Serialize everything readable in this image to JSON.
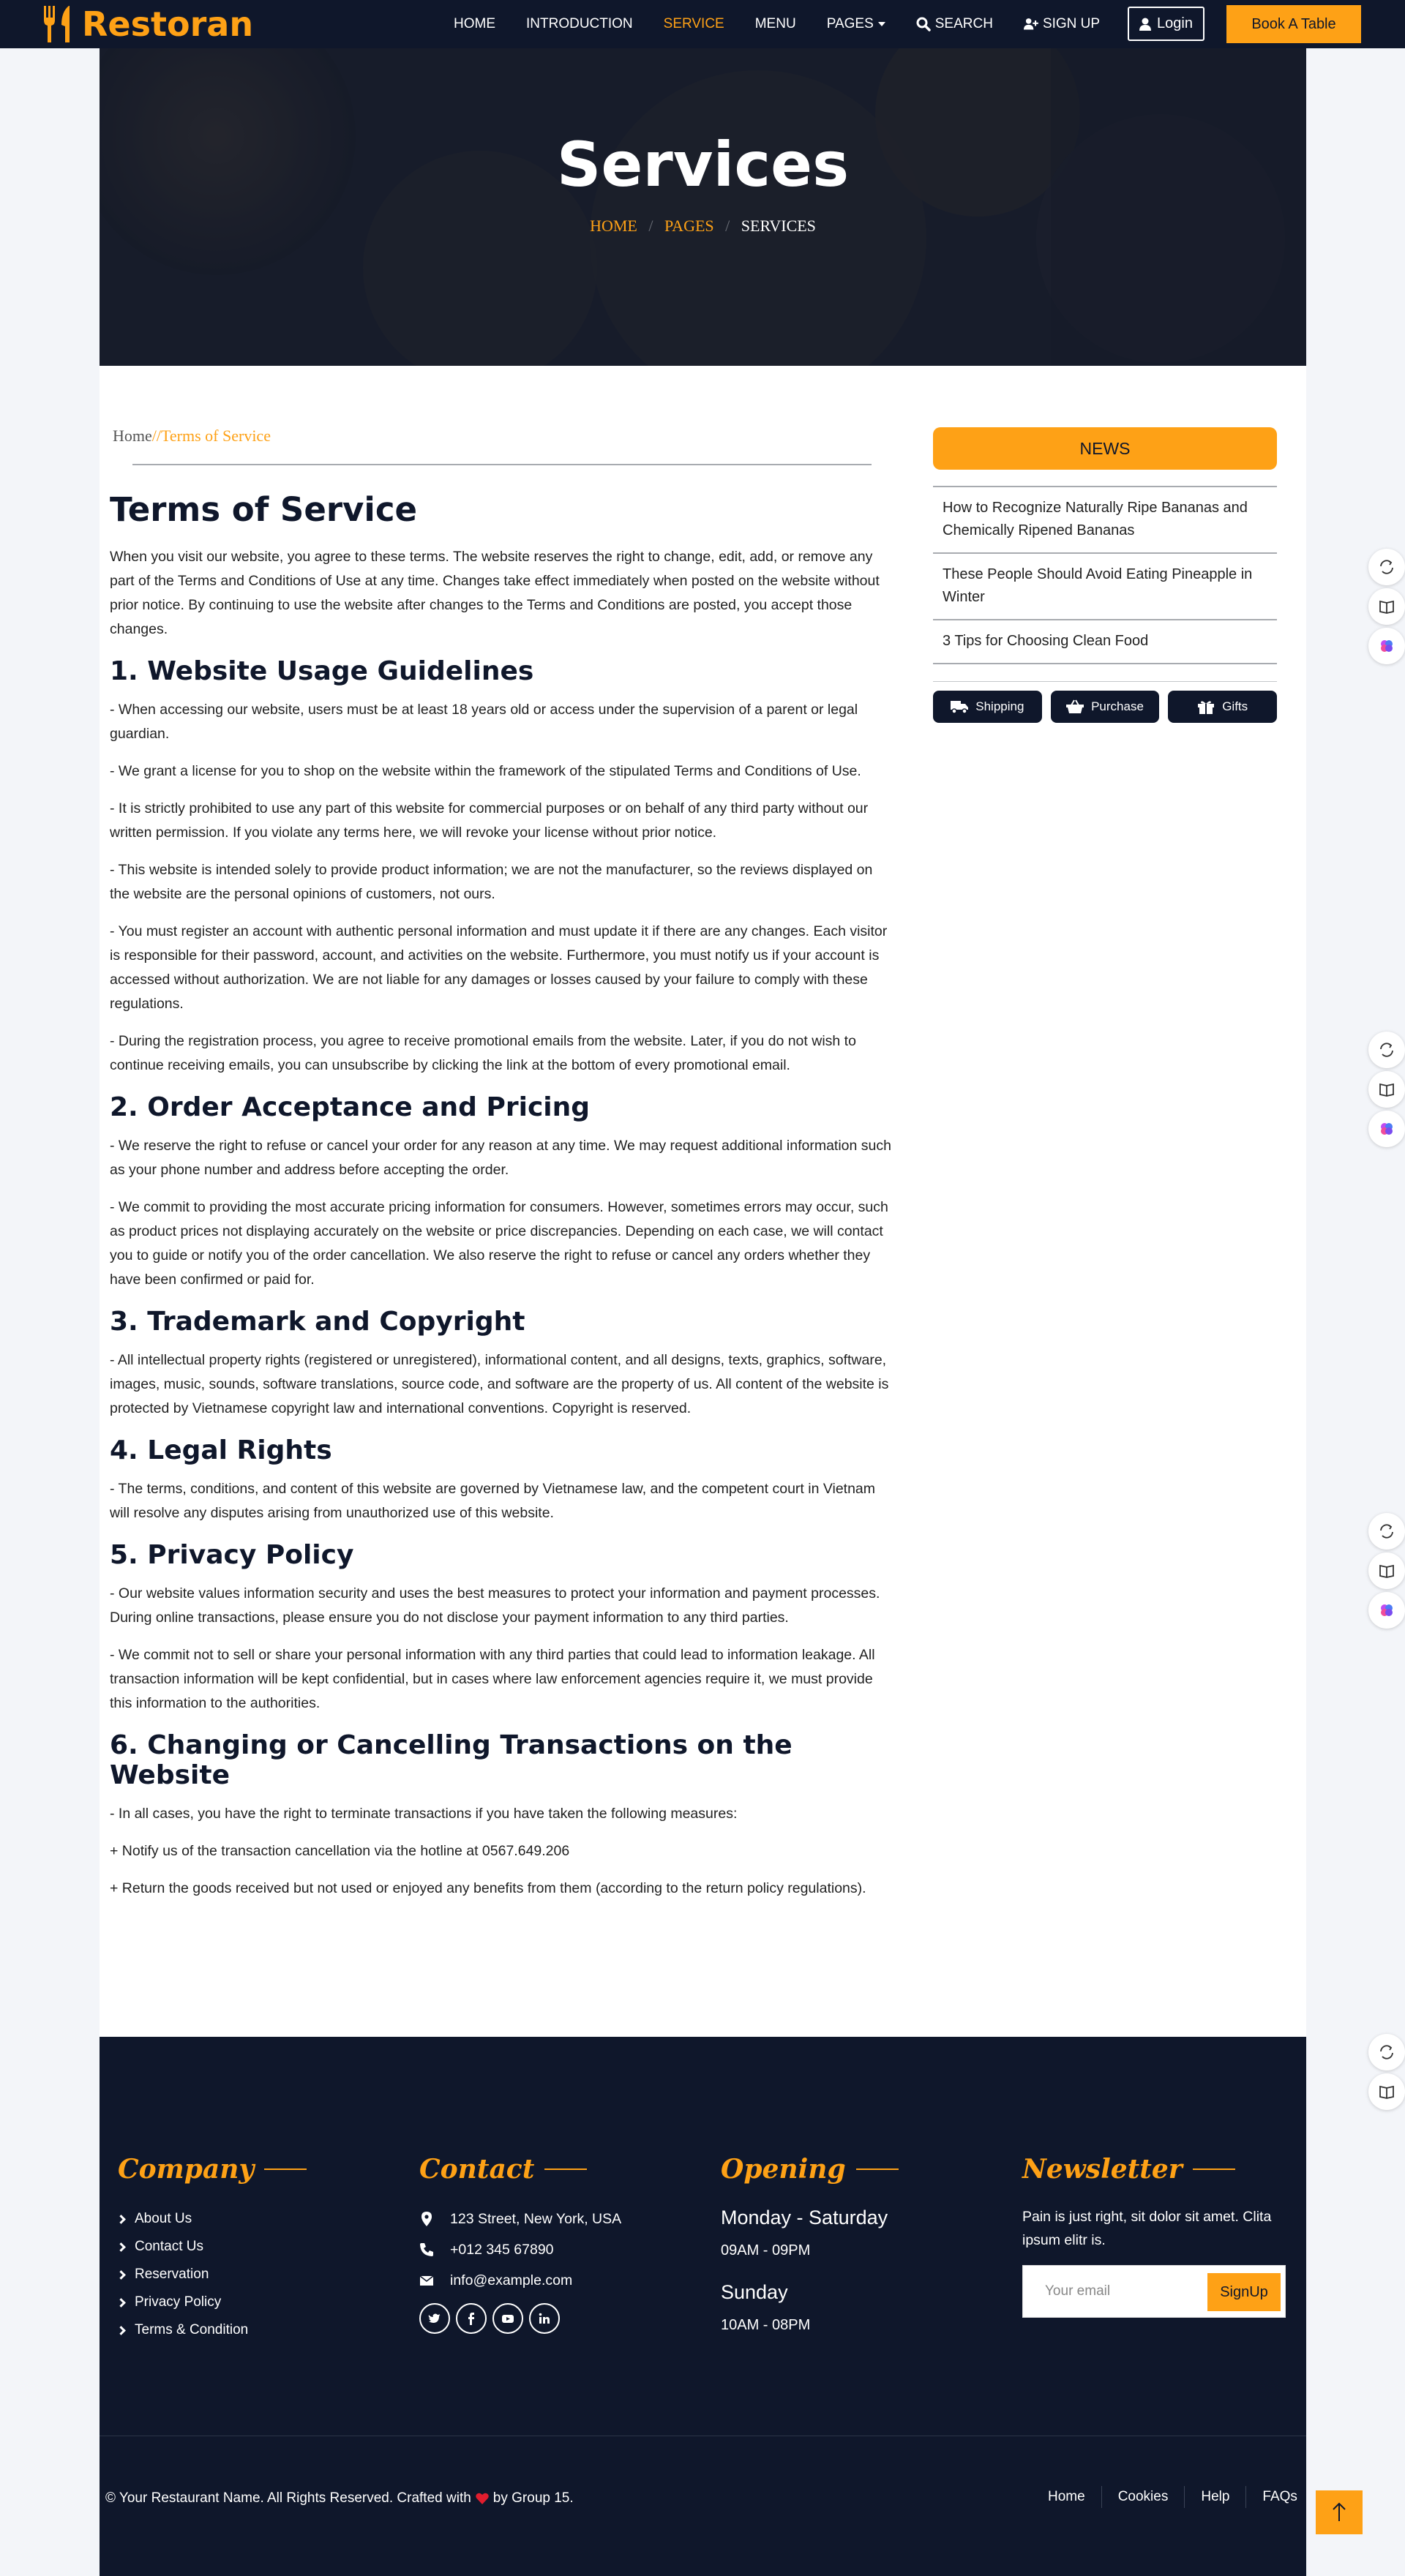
{
  "brand": {
    "name": "Restoran"
  },
  "nav": {
    "items": [
      {
        "label": "HOME"
      },
      {
        "label": "INTRODUCTION"
      },
      {
        "label": "SERVICE"
      },
      {
        "label": "MENU"
      },
      {
        "label": "PAGES"
      }
    ],
    "search_label": "SEARCH",
    "signup_label": "SIGN UP",
    "login_label": "Login",
    "book_label": "Book A Table"
  },
  "hero": {
    "title": "Services",
    "breadcrumb": {
      "home": "HOME",
      "sep": "/",
      "pages": "PAGES",
      "current": "SERVICES"
    }
  },
  "page_breadcrumb": {
    "home": "Home",
    "sep": "//",
    "current": "Terms of Service"
  },
  "article": {
    "title": "Terms of Service",
    "intro": "When you visit our website, you agree to these terms. The website reserves the right to change, edit, add, or remove any part of the Terms and Conditions of Use at any time. Changes take effect immediately when posted on the website without prior notice. By continuing to use the website after changes to the Terms and Conditions are posted, you accept those changes.",
    "sections": [
      {
        "heading": "1. Website Usage Guidelines",
        "paragraphs": [
          "- When accessing our website, users must be at least 18 years old or access under the supervision of a parent or legal guardian.",
          "- We grant a license for you to shop on the website within the framework of the stipulated Terms and Conditions of Use.",
          "- It is strictly prohibited to use any part of this website for commercial purposes or on behalf of any third party without our written permission. If you violate any terms here, we will revoke your license without prior notice.",
          "- This website is intended solely to provide product information; we are not the manufacturer, so the reviews displayed on the website are the personal opinions of customers, not ours.",
          "- You must register an account with authentic personal information and must update it if there are any changes. Each visitor is responsible for their password, account, and activities on the website. Furthermore, you must notify us if your account is accessed without authorization. We are not liable for any damages or losses caused by your failure to comply with these regulations.",
          "- During the registration process, you agree to receive promotional emails from the website. Later, if you do not wish to continue receiving emails, you can unsubscribe by clicking the link at the bottom of every promotional email."
        ]
      },
      {
        "heading": "2. Order Acceptance and Pricing",
        "paragraphs": [
          "- We reserve the right to refuse or cancel your order for any reason at any time. We may request additional information such as your phone number and address before accepting the order.",
          "- We commit to providing the most accurate pricing information for consumers. However, sometimes errors may occur, such as product prices not displaying accurately on the website or price discrepancies. Depending on each case, we will contact you to guide or notify you of the order cancellation. We also reserve the right to refuse or cancel any orders whether they have been confirmed or paid for."
        ]
      },
      {
        "heading": "3. Trademark and Copyright",
        "paragraphs": [
          "- All intellectual property rights (registered or unregistered), informational content, and all designs, texts, graphics, software, images, music, sounds, software translations, source code, and software are the property of us. All content of the website is protected by Vietnamese copyright law and international conventions. Copyright is reserved."
        ]
      },
      {
        "heading": "4. Legal Rights",
        "paragraphs": [
          "- The terms, conditions, and content of this website are governed by Vietnamese law, and the competent court in Vietnam will resolve any disputes arising from unauthorized use of this website."
        ]
      },
      {
        "heading": "5. Privacy Policy",
        "paragraphs": [
          "- Our website values information security and uses the best measures to protect your information and payment processes. During online transactions, please ensure you do not disclose your payment information to any third parties.",
          "- We commit not to sell or share your personal information with any third parties that could lead to information leakage. All transaction information will be kept confidential, but in cases where law enforcement agencies require it, we must provide this information to the authorities."
        ]
      },
      {
        "heading": "6. Changing or Cancelling Transactions on the Website",
        "paragraphs": [
          "- In all cases, you have the right to terminate transactions if you have taken the following measures:",
          "+ Notify us of the transaction cancellation via the hotline at 0567.649.206",
          "+ Return the goods received but not used or enjoyed any benefits from them (according to the return policy regulations)."
        ]
      }
    ]
  },
  "sidebar": {
    "news_title": "NEWS",
    "news": [
      {
        "title": "How to Recognize Naturally Ripe Bananas and Chemically Ripened Bananas"
      },
      {
        "title": "These People Should Avoid Eating Pineapple in Winter"
      },
      {
        "title": "3 Tips for Choosing Clean Food"
      }
    ],
    "tabs": [
      {
        "label": "Shipping",
        "icon": "truck-icon"
      },
      {
        "label": "Purchase",
        "icon": "basket-icon"
      },
      {
        "label": "Gifts",
        "icon": "gift-icon"
      }
    ]
  },
  "footer": {
    "company": {
      "title": "Company",
      "links": [
        "About Us",
        "Contact Us",
        "Reservation",
        "Privacy Policy",
        "Terms & Condition"
      ]
    },
    "contact": {
      "title": "Contact",
      "address": "123 Street, New York, USA",
      "phone": "+012 345 67890",
      "email": "info@example.com"
    },
    "opening": {
      "title": "Opening",
      "day1": "Monday - Saturday",
      "time1": "09AM - 09PM",
      "day2": "Sunday",
      "time2": "10AM - 08PM"
    },
    "newsletter": {
      "title": "Newsletter",
      "text": "Pain is just right, sit dolor sit amet. Clita ipsum elitr is.",
      "placeholder": "Your email",
      "button": "SignUp"
    },
    "copyright_before": "© Your Restaurant Name. All Rights Reserved. Crafted with",
    "copyright_after": "by Group 15.",
    "nav": [
      "Home",
      "Cookies",
      "Help",
      "FAQs"
    ]
  },
  "colors": {
    "accent": "#fea116",
    "dark": "#0f172b",
    "heart": "#e11d2e"
  }
}
